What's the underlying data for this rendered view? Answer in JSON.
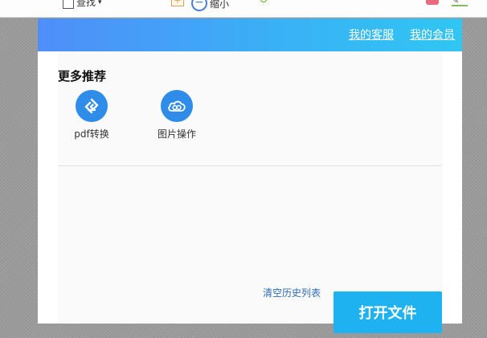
{
  "toolbar": {
    "find_label": "查找",
    "zoom_out_label": "缩小"
  },
  "header": {
    "links": [
      "我的客服",
      "我的会员"
    ]
  },
  "recommend": {
    "title": "更多推荐",
    "tools": [
      {
        "label": "pdf转换",
        "icon": "pdf-convert-icon"
      },
      {
        "label": "图片操作",
        "icon": "image-cloud-icon"
      }
    ]
  },
  "footer": {
    "clear_history": "清空历史列表",
    "open_file": "打开文件"
  },
  "colors": {
    "header_start": "#4f8ef9",
    "header_end": "#30c6f2",
    "icon_blue": "#2f8de9",
    "button_blue": "#1fb2f1",
    "link_blue": "#2d6db5"
  }
}
